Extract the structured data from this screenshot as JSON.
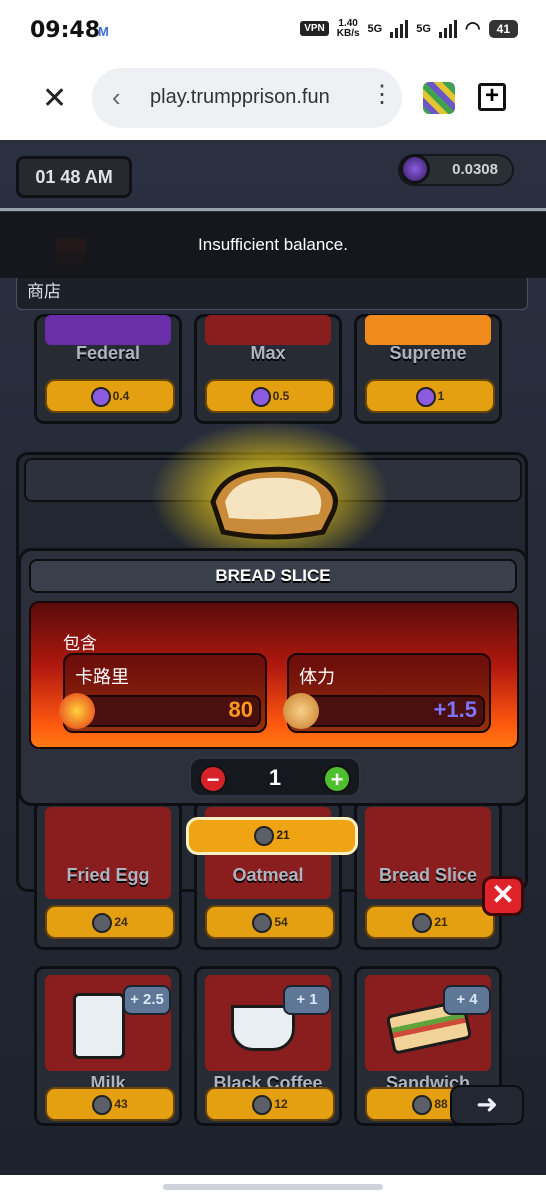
{
  "status_bar": {
    "time": "09:48",
    "notification": "M",
    "vpn": "VPN",
    "speed": "1.40",
    "speed_unit": "KB/s",
    "net1": "5G",
    "net2": "5G",
    "battery": "41"
  },
  "browser": {
    "url": "play.trumpprison.fun"
  },
  "game": {
    "clock": "01 48 AM",
    "balance": "0.0308",
    "toast": "Insufficient balance.",
    "store_title": "商店",
    "row1": [
      {
        "name": "Federal",
        "price": "0.4"
      },
      {
        "name": "Max",
        "price": "0.5"
      },
      {
        "name": "Supreme",
        "price": "1"
      }
    ],
    "row2": [
      {
        "name": "Fried Egg",
        "price": "24"
      },
      {
        "name": "Oatmeal",
        "price": "54"
      },
      {
        "name": "Bread Slice",
        "price": "21"
      }
    ],
    "row3": [
      {
        "name": "Milk",
        "price": "43",
        "badge": "+ 2.5"
      },
      {
        "name": "Black Coffee",
        "price": "12",
        "badge": "+ 1"
      },
      {
        "name": "Sandwich",
        "price": "88",
        "badge": "+ 4"
      }
    ],
    "dialog": {
      "title": "BREAD SLICE",
      "include_label": "包含",
      "calorie_label": "卡路里",
      "calorie_value": "80",
      "stamina_label": "体力",
      "stamina_value": "+1.5",
      "quantity": "1",
      "buy_price": "21"
    }
  }
}
